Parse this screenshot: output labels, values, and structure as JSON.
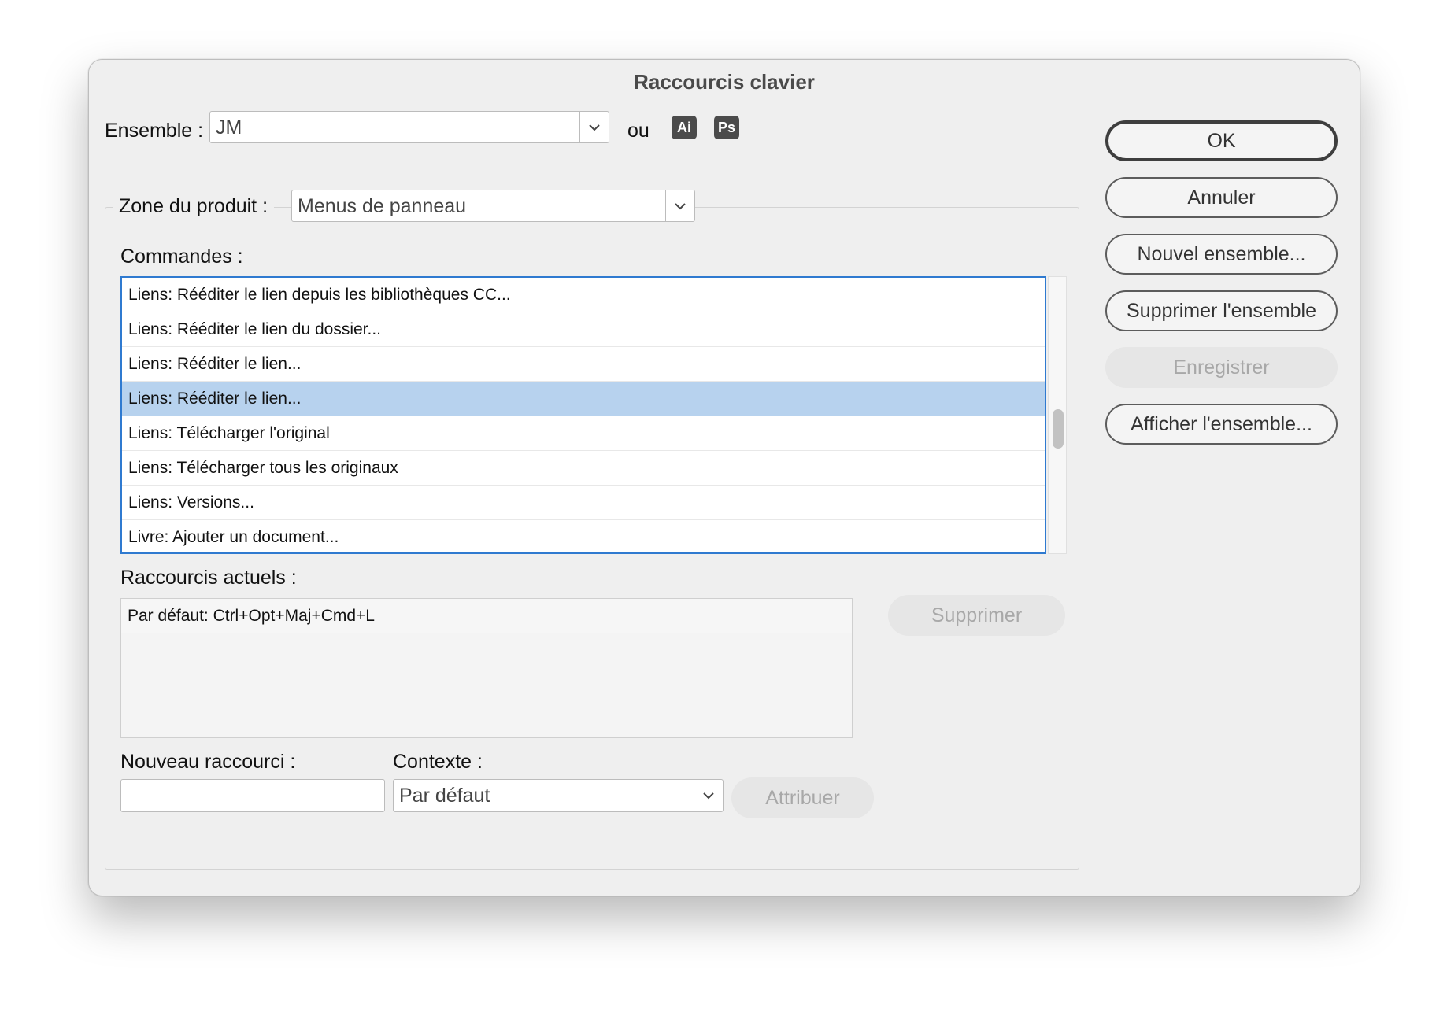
{
  "window": {
    "title": "Raccourcis clavier"
  },
  "ensemble": {
    "label": "Ensemble :",
    "value": "JM",
    "or_label": "ou",
    "badges": [
      "Ai",
      "Ps"
    ]
  },
  "zone": {
    "label": "Zone du produit :",
    "value": "Menus de panneau"
  },
  "commandes": {
    "label": "Commandes :",
    "items": [
      "Liens: Rééditer le lien depuis les bibliothèques CC...",
      "Liens: Rééditer le lien du dossier...",
      "Liens: Rééditer le lien...",
      "Liens: Rééditer le lien...",
      "Liens: Télécharger l'original",
      "Liens: Télécharger tous les originaux",
      "Liens: Versions...",
      "Livre: Ajouter un document..."
    ],
    "selected_index": 3
  },
  "raccourcis_actuels": {
    "label": "Raccourcis actuels :",
    "items": [
      "Par défaut: Ctrl+Opt+Maj+Cmd+L"
    ],
    "remove_button": "Supprimer"
  },
  "nouveau_raccourci": {
    "label": "Nouveau raccourci :",
    "value": ""
  },
  "contexte": {
    "label": "Contexte :",
    "value": "Par défaut"
  },
  "assign_button": "Attribuer",
  "buttons": {
    "ok": "OK",
    "cancel": "Annuler",
    "new_set": "Nouvel ensemble...",
    "delete_set": "Supprimer l'ensemble",
    "save": "Enregistrer",
    "show_set": "Afficher l'ensemble..."
  },
  "colors": {
    "selection": "#b7d2ee",
    "focus_ring": "#2f7ad0",
    "badge_bg": "#4b4b4b"
  }
}
